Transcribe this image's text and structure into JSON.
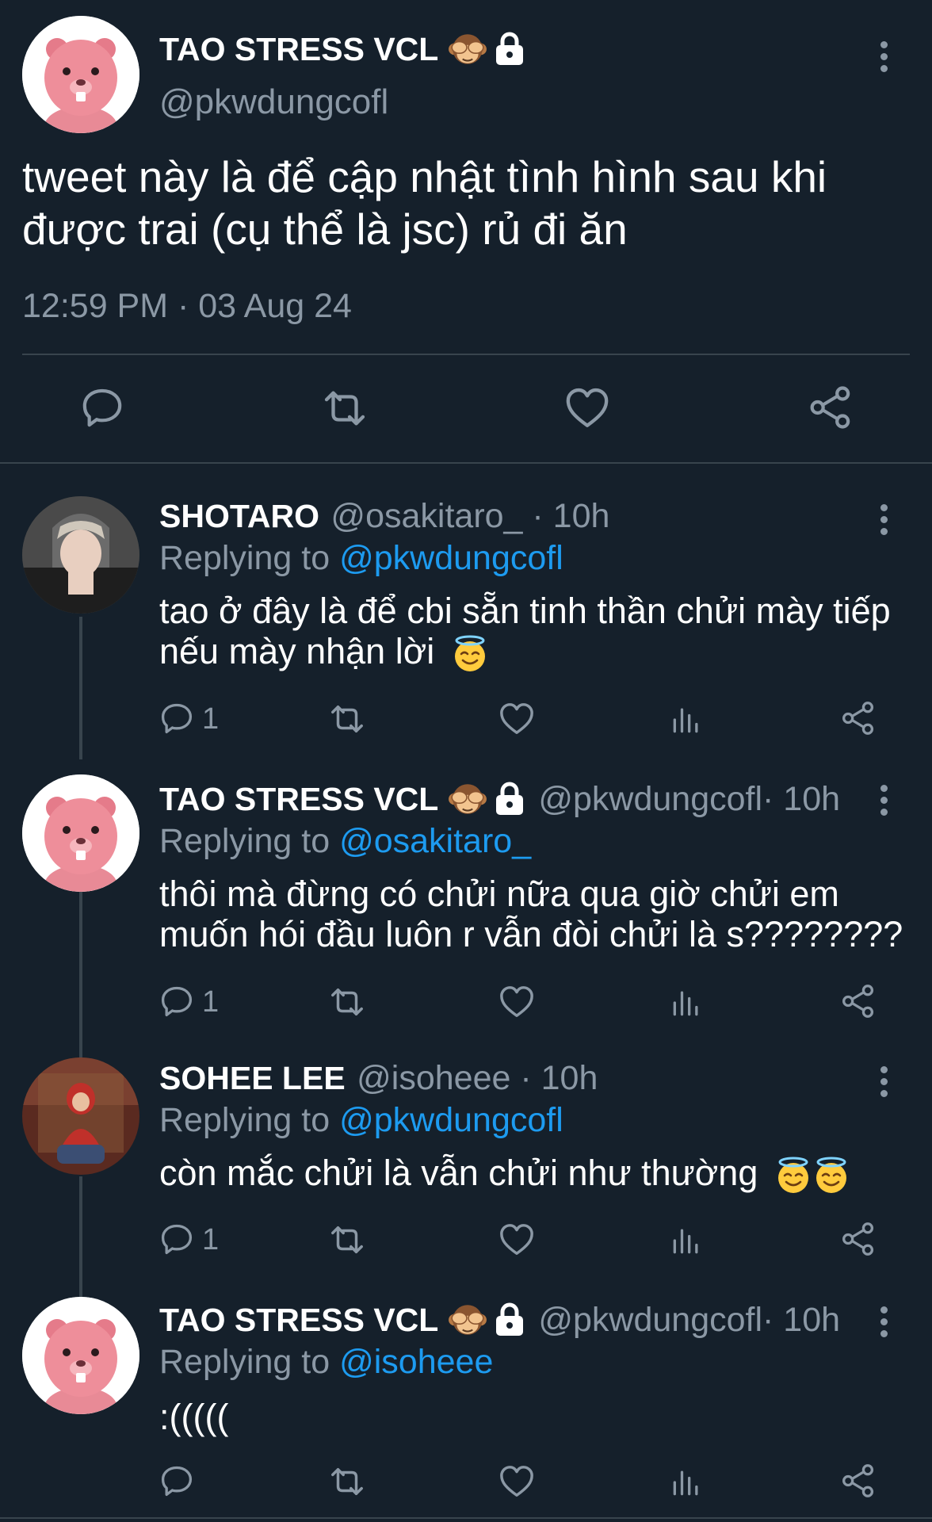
{
  "main_tweet": {
    "name": "TAO STRESS VCL",
    "handle": "@pkwdungcofl",
    "text_line1": "tweet này là để cập nhật tình hình sau khi",
    "text_line2": "được trai (cụ thể là jsc) rủ đi ăn",
    "timestamp": "12:59 PM · 03 Aug 24"
  },
  "replies": [
    {
      "name": "SHOTARO",
      "handle": "@osakitaro_",
      "time": " · 10h",
      "replying_label": "Replying to ",
      "replying_to": "@pkwdungcofl",
      "text_line1": "tao ở đây là để cbi sẵn tinh thần chửi mày tiếp",
      "text_line2": "nếu mày nhận lời",
      "reply_count": "1"
    },
    {
      "name": "TAO STRESS VCL",
      "handle": "@pkwdungcofl",
      "time": " · 10h",
      "replying_label": "Replying to ",
      "replying_to": "@osakitaro_",
      "text_line1": "thôi mà đừng có chửi nữa qua giờ chửi em",
      "text_line2": "muốn hói đầu luôn r vẫn đòi chửi là s????????",
      "reply_count": "1"
    },
    {
      "name": "SOHEE LEE",
      "handle": "@isoheee",
      "time": " · 10h",
      "replying_label": "Replying to ",
      "replying_to": "@pkwdungcofl",
      "text_line1": "còn mắc chửi là vẫn chửi như thường",
      "reply_count": "1"
    },
    {
      "name": "TAO STRESS VCL",
      "handle": "@pkwdungcofl",
      "time": " · 10h",
      "replying_label": "Replying to ",
      "replying_to": "@isoheee",
      "text_line1": ":(((((",
      "reply_count": ""
    }
  ],
  "icons": {
    "reply": "reply-icon",
    "retweet": "retweet-icon",
    "like": "heart-icon",
    "views": "views-icon",
    "share": "share-icon",
    "more": "more-vertical-icon",
    "lock": "lock-icon",
    "monkey": "see-no-evil-monkey-emoji",
    "halo": "smiling-face-with-halo-emoji"
  },
  "colors": {
    "background": "#15202b",
    "muted": "#8b98a5",
    "link": "#1d9bf0",
    "divider": "#38444d"
  }
}
